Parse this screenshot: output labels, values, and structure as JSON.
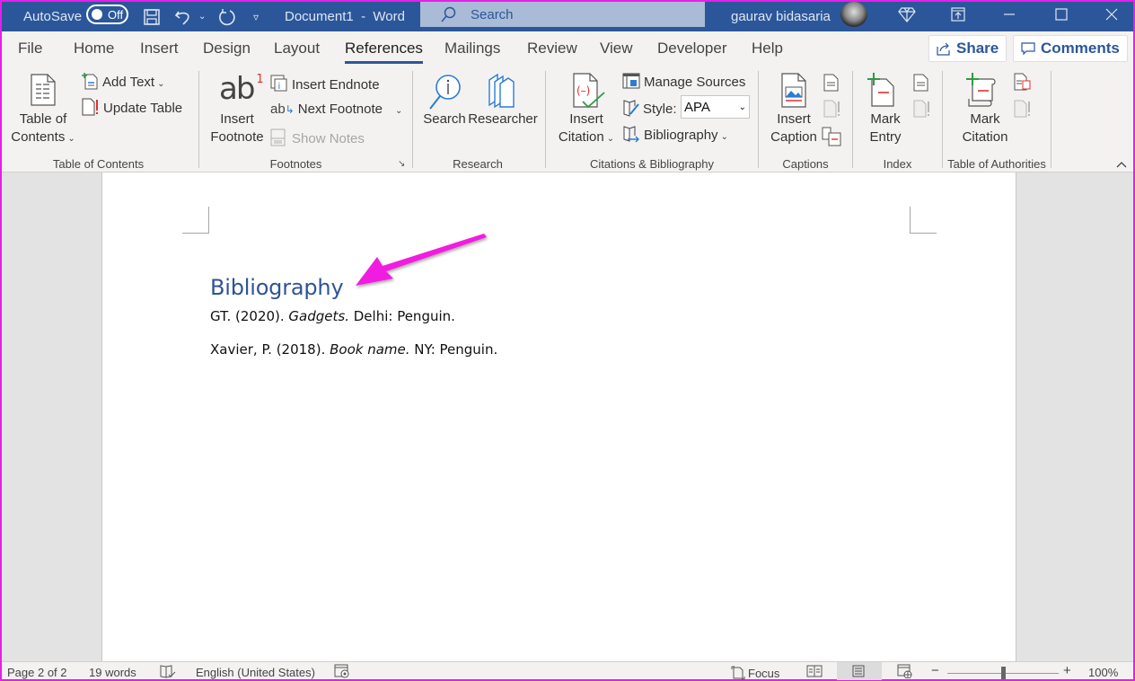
{
  "titlebar": {
    "autosave_label": "AutoSave",
    "autosave_state": "Off",
    "doc_title": "Document1",
    "separator": "-",
    "app_name": "Word",
    "search_placeholder": "Search",
    "user_name": "gaurav bidasaria"
  },
  "tabs": [
    {
      "label": "File"
    },
    {
      "label": "Home"
    },
    {
      "label": "Insert"
    },
    {
      "label": "Design"
    },
    {
      "label": "Layout"
    },
    {
      "label": "References",
      "active": true
    },
    {
      "label": "Mailings"
    },
    {
      "label": "Review"
    },
    {
      "label": "View"
    },
    {
      "label": "Developer"
    },
    {
      "label": "Help"
    }
  ],
  "share_label": "Share",
  "comments_label": "Comments",
  "ribbon": {
    "toc": {
      "group_label": "Table of Contents",
      "big_line1": "Table of",
      "big_line2": "Contents",
      "add_text": "Add Text",
      "update_table": "Update Table"
    },
    "footnotes": {
      "group_label": "Footnotes",
      "big_line1": "Insert",
      "big_line2": "Footnote",
      "insert_endnote": "Insert Endnote",
      "next_footnote": "Next Footnote",
      "show_notes": "Show Notes"
    },
    "research": {
      "group_label": "Research",
      "search": "Search",
      "researcher": "Researcher"
    },
    "citations": {
      "group_label": "Citations & Bibliography",
      "big_line1": "Insert",
      "big_line2": "Citation",
      "manage_sources": "Manage Sources",
      "style_label": "Style:",
      "style_value": "APA",
      "bibliography": "Bibliography"
    },
    "captions": {
      "group_label": "Captions",
      "big_line1": "Insert",
      "big_line2": "Caption"
    },
    "index": {
      "group_label": "Index",
      "big_line1": "Mark",
      "big_line2": "Entry"
    },
    "authorities": {
      "group_label": "Table of Authorities",
      "big_line1": "Mark",
      "big_line2": "Citation"
    }
  },
  "document": {
    "heading": "Bibliography",
    "entries": [
      {
        "pre": "GT. (2020). ",
        "title": "Gadgets.",
        "post": " Delhi: Penguin."
      },
      {
        "pre": "Xavier, P. (2018). ",
        "title": "Book name.",
        "post": " NY: Penguin."
      }
    ],
    "annotation_color": "#f21ee0"
  },
  "statusbar": {
    "page": "Page 2 of 2",
    "words": "19 words",
    "language": "English (United States)",
    "focus": "Focus",
    "zoom_percent": "100%",
    "zoom_level": 100
  },
  "colors": {
    "accent": "#2b579a",
    "heading": "#2f5496"
  }
}
